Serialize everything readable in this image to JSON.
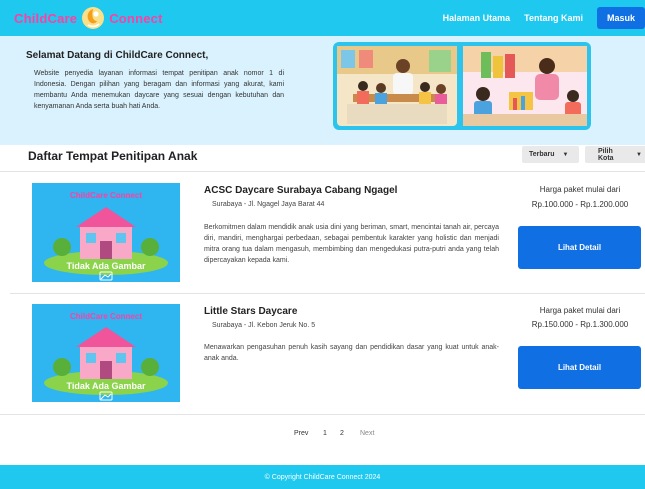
{
  "navbar": {
    "brand_left": "ChildCare",
    "brand_right": "Connect",
    "links": [
      "Halaman Utama",
      "Tentang Kami"
    ],
    "login_label": "Masuk"
  },
  "hero": {
    "title": "Selamat Datang di ChildCare Connect,",
    "text": "Website penyedia layanan informasi tempat penitipan anak nomor 1 di Indonesia. Dengan pilihan yang beragam dan informasi yang akurat, kami membantu Anda menemukan daycare yang sesuai dengan kebutuhan dan kenyamanan Anda serta buah hati Anda."
  },
  "listing": {
    "title": "Daftar Tempat Penitipan Anak",
    "sort_label": "Terbaru",
    "city_label": "Pilih Kota"
  },
  "placeholder": {
    "banner": "ChildCare Connect",
    "caption": "Tidak Ada Gambar"
  },
  "cards": [
    {
      "name": "ACSC Daycare Surabaya Cabang Ngagel",
      "address": "Surabaya - Jl. Ngagel Jaya Barat 44",
      "description": "Berkomitmen dalam mendidik anak usia dini yang beriman, smart, mencintai tanah air, percaya diri, mandiri, menghargai perbedaan, sebagai pembentuk karakter yang holistic dan menjadi mitra orang tua dalam mengasuh, membimbing dan mengedukasi putra-putri anda yang telah dipercayakan kepada kami.",
      "price_label": "Harga paket mulai dari",
      "price_range": "Rp.100.000 - Rp.1.200.000",
      "button_label": "Lihat Detail"
    },
    {
      "name": "Little Stars Daycare",
      "address": "Surabaya - Jl. Kebon Jeruk No. 5",
      "description": "Menawarkan pengasuhan penuh kasih sayang dan pendidikan dasar yang kuat untuk anak-anak anda.",
      "price_label": "Harga paket mulai dari",
      "price_range": "Rp.150.000 - Rp.1.300.000",
      "button_label": "Lihat Detail"
    }
  ],
  "pagination": {
    "prev": "Prev",
    "pages": [
      "1",
      "2"
    ],
    "next": "Next"
  },
  "footer": {
    "text": "© Copyright ChildCare Connect 2024"
  },
  "colors": {
    "navbar": "#1ec8ee",
    "brand": "#ff3fa4",
    "primary_button": "#0f6fe3",
    "hero_background": "#d9f2fd"
  },
  "icons": [
    "childcare-logo-icon",
    "chevron-down-icon",
    "image-icon"
  ]
}
